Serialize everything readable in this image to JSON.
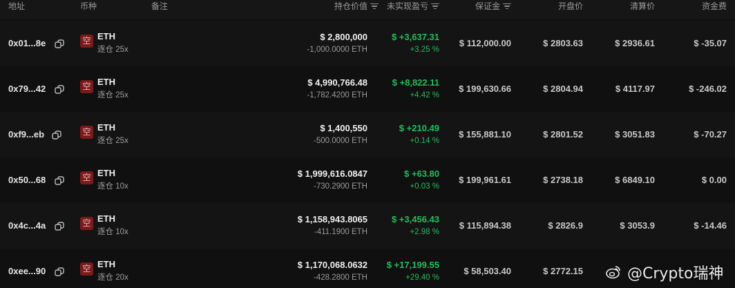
{
  "columns": {
    "address": "地址",
    "coin": "币种",
    "note": "备注",
    "position_value": "持仓价值",
    "unrealized_pnl": "未实现盈亏",
    "margin": "保证金",
    "entry_price": "开盘价",
    "liq_price": "清算价",
    "funding_fee": "资金费"
  },
  "icons": {
    "copy": "copy-icon",
    "sort": "sort-filter-icon",
    "watermark_logo": "weibo-logo-icon"
  },
  "colors": {
    "background": "#101010",
    "profit": "#1fbf5b",
    "loss": "#e03535",
    "short_badge": "#7a1a1a"
  },
  "rows": [
    {
      "address": "0x01...8e",
      "side": "空",
      "coin": "ETH",
      "leverage": "逐仓 25x",
      "position_value": "$ 2,800,000",
      "position_size": "-1,000.0000 ETH",
      "pnl": "$ +3,637.31",
      "pnl_pct": "+3.25 %",
      "margin": "$ 112,000.00",
      "entry_price": "$ 2803.63",
      "liq_price": "$ 2936.61",
      "funding_fee": "$ -35.07"
    },
    {
      "address": "0x79...42",
      "side": "空",
      "coin": "ETH",
      "leverage": "逐仓 25x",
      "position_value": "$ 4,990,766.48",
      "position_size": "-1,782.4200 ETH",
      "pnl": "$ +8,822.11",
      "pnl_pct": "+4.42 %",
      "margin": "$ 199,630.66",
      "entry_price": "$ 2804.94",
      "liq_price": "$ 4117.97",
      "funding_fee": "$ -246.02"
    },
    {
      "address": "0xf9...eb",
      "side": "空",
      "coin": "ETH",
      "leverage": "逐仓 25x",
      "position_value": "$ 1,400,550",
      "position_size": "-500.0000 ETH",
      "pnl": "$ +210.49",
      "pnl_pct": "+0.14 %",
      "margin": "$ 155,881.10",
      "entry_price": "$ 2801.52",
      "liq_price": "$ 3051.83",
      "funding_fee": "$ -70.27"
    },
    {
      "address": "0x50...68",
      "side": "空",
      "coin": "ETH",
      "leverage": "逐仓 10x",
      "position_value": "$ 1,999,616.0847",
      "position_size": "-730.2900 ETH",
      "pnl": "$ +63.80",
      "pnl_pct": "+0.03 %",
      "margin": "$ 199,961.61",
      "entry_price": "$ 2738.18",
      "liq_price": "$ 6849.10",
      "funding_fee": "$ 0.00"
    },
    {
      "address": "0x4c...4a",
      "side": "空",
      "coin": "ETH",
      "leverage": "逐仓 10x",
      "position_value": "$ 1,158,943.8065",
      "position_size": "-411.1900 ETH",
      "pnl": "$ +3,456.43",
      "pnl_pct": "+2.98 %",
      "margin": "$ 115,894.38",
      "entry_price": "$ 2826.9",
      "liq_price": "$ 3053.9",
      "funding_fee": "$ -14.46"
    },
    {
      "address": "0xee...90",
      "side": "空",
      "coin": "ETH",
      "leverage": "逐仓 20x",
      "position_value": "$ 1,170,068.0632",
      "position_size": "-428.2800 ETH",
      "pnl": "$ +17,199.55",
      "pnl_pct": "+29.40 %",
      "margin": "$ 58,503.40",
      "entry_price": "$ 2772.15",
      "liq_price": "",
      "funding_fee": ""
    }
  ],
  "watermark": {
    "text": "@Crypto瑞神"
  }
}
